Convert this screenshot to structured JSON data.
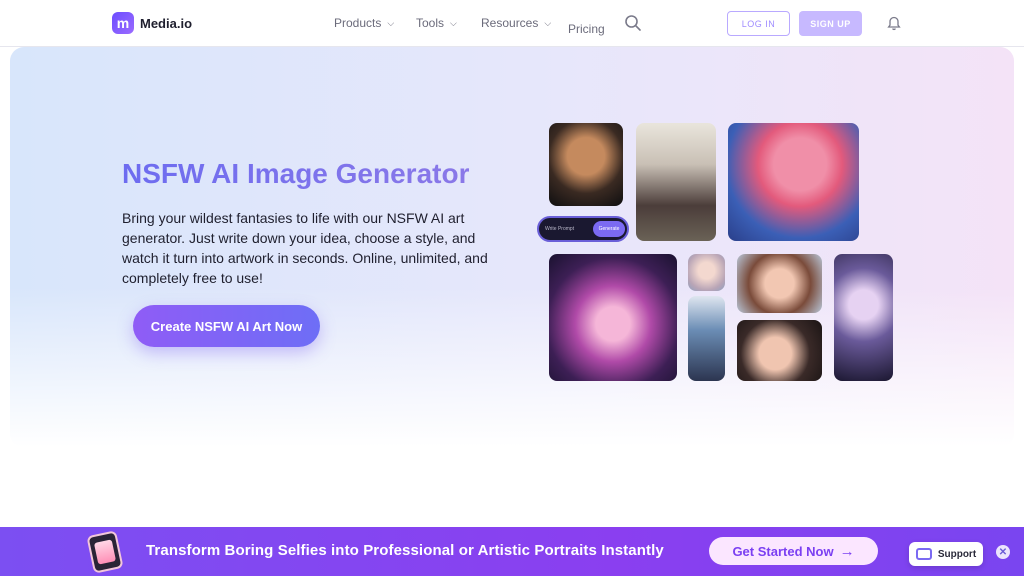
{
  "nav": {
    "logo_text": "Media.io",
    "logo_letter": "m",
    "items": [
      {
        "label": "Products",
        "has_dropdown": true
      },
      {
        "label": "Tools",
        "has_dropdown": true
      },
      {
        "label": "Resources",
        "has_dropdown": true
      },
      {
        "label": "Pricing",
        "has_dropdown": false
      }
    ],
    "search_icon": "search-icon",
    "login_label": "LOG IN",
    "signup_label": "SIGN UP",
    "bell_icon": "bell-icon"
  },
  "hero": {
    "title": "NSFW AI Image Generator",
    "description": "Bring your wildest fantasies to life with our NSFW AI art generator. Just write down your idea, choose a style, and watch it turn into artwork in seconds. Online, unlimited, and completely free to use!",
    "cta_label": "Create NSFW AI Art Now",
    "prompt_placeholder": "Write Prompt",
    "prompt_generate": "Generate"
  },
  "banner": {
    "text": "Transform Boring Selfies into Professional or Artistic Portraits Instantly",
    "cta_label": "Get Started Now",
    "cta_arrow": "→"
  },
  "support": {
    "label": "Support",
    "close_glyph": "✕"
  },
  "colors": {
    "accent": "#7b6af2",
    "banner_bg": "#8a3ff0",
    "title_gradient_start": "#6d6cf0",
    "title_gradient_end": "#8a78e8"
  }
}
